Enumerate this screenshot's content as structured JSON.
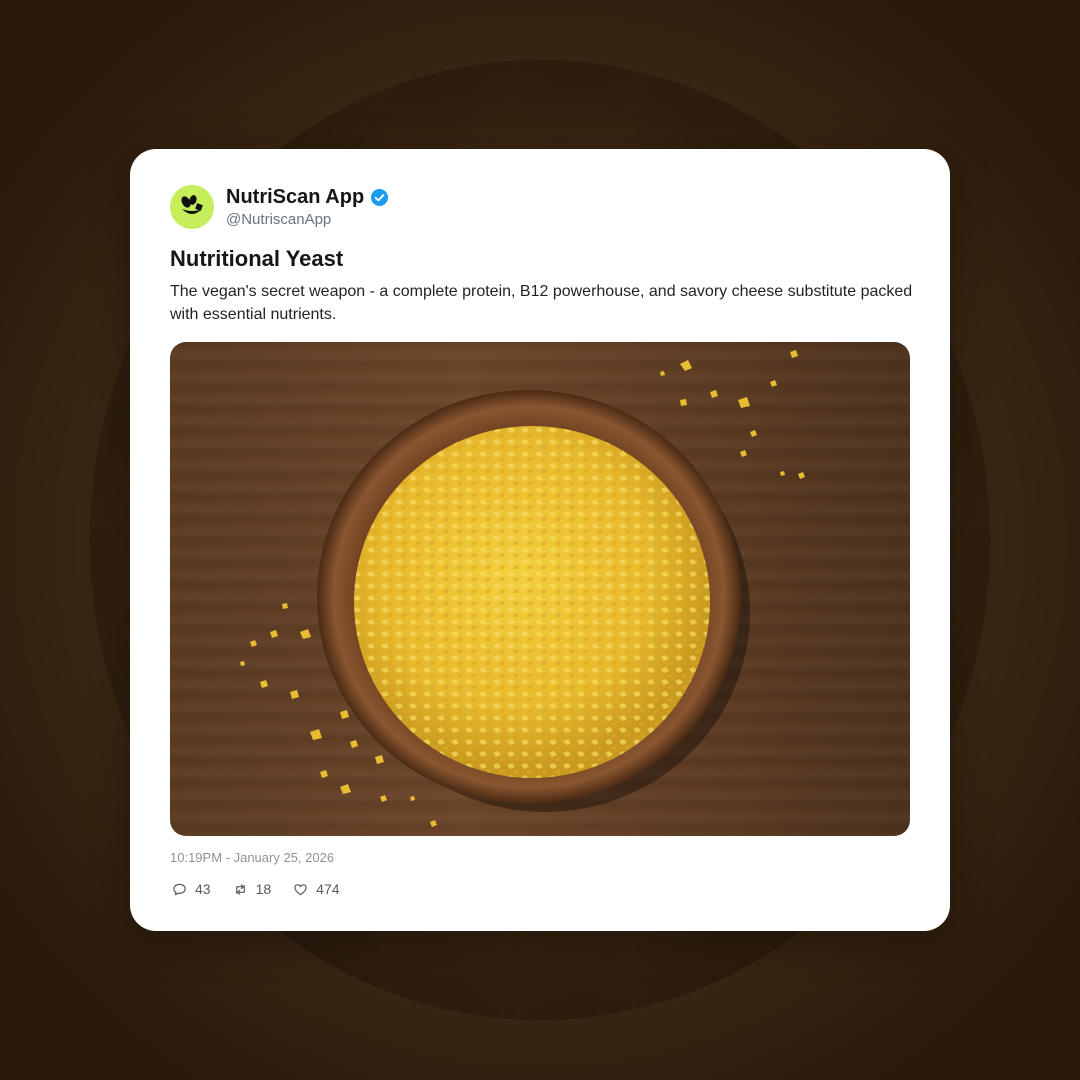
{
  "post": {
    "author_name": "NutriScan App",
    "author_handle": "@NutriscanApp",
    "verified": true,
    "title": "Nutritional Yeast",
    "description": "The vegan's secret weapon - a complete protein, B12 powerhouse, and savory cheese substitute packed with essential nutrients.",
    "timestamp": "10:19PM - January 25, 2026",
    "stats": {
      "replies": "43",
      "reposts": "18",
      "likes": "474"
    }
  },
  "colors": {
    "avatar_bg": "#c5ee5a",
    "verified_badge": "#1d9bf0",
    "card_bg": "#ffffff"
  },
  "icons": {
    "avatar": "leaf-logo-icon",
    "verified": "verified-badge-icon",
    "reply": "comment-icon",
    "repost": "repost-icon",
    "like": "heart-icon"
  }
}
